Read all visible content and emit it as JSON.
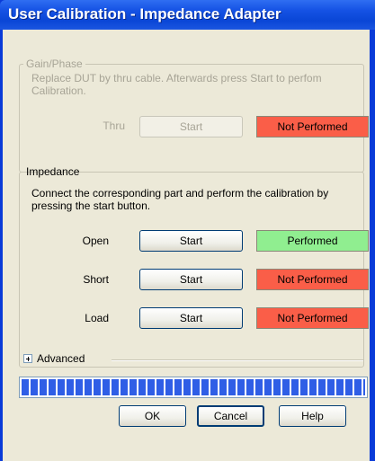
{
  "window": {
    "title": "User Calibration - Impedance Adapter"
  },
  "gain_phase": {
    "legend": "Gain/Phase",
    "description": "Replace DUT by thru cable. Afterwards press Start to perfom Calibration.",
    "row": {
      "label": "Thru",
      "button": "Start",
      "status": "Not Performed"
    }
  },
  "impedance": {
    "legend": "Impedance",
    "description": "Connect the corresponding part and perform the calibration by pressing the start button.",
    "rows": [
      {
        "label": "Open",
        "button": "Start",
        "status": "Performed"
      },
      {
        "label": "Short",
        "button": "Start",
        "status": "Not Performed"
      },
      {
        "label": "Load",
        "button": "Start",
        "status": "Not Performed"
      }
    ]
  },
  "advanced": {
    "label": "Advanced"
  },
  "progress": {
    "value": 1.0
  },
  "buttons": {
    "ok": "OK",
    "cancel": "Cancel",
    "help": "Help"
  },
  "colors": {
    "performed": "#90ee90",
    "not_performed": "#fa5e48",
    "progress": "#2f5ee6"
  }
}
